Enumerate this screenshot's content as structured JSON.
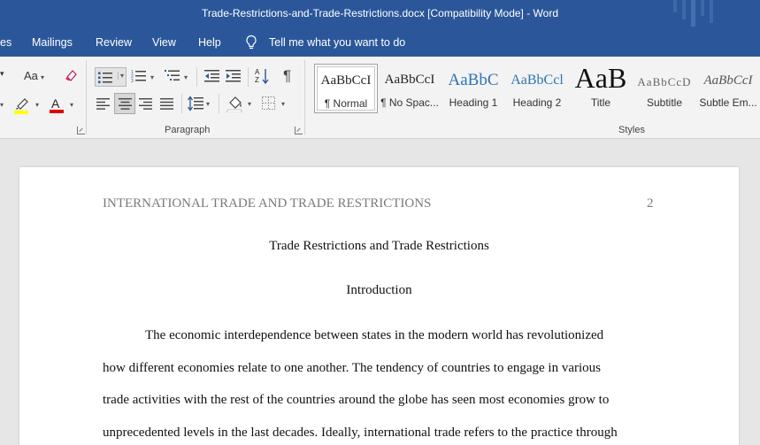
{
  "window": {
    "title": "Trade-Restrictions-and-Trade-Restrictions.docx [Compatibility Mode]  -  Word",
    "theme_color": "#2b579a"
  },
  "menu": {
    "items": [
      "es",
      "Mailings",
      "Review",
      "View",
      "Help"
    ],
    "tell_me": "Tell me what you want to do"
  },
  "ribbon": {
    "font_group": {
      "change_case_label": "Aa",
      "highlight_color": "#ffff00",
      "font_color": "#e00000"
    },
    "paragraph_group": {
      "label": "Paragraph",
      "pilcrow": "¶"
    },
    "styles_group": {
      "label": "Styles",
      "styles": [
        {
          "sample": "AaBbCcI",
          "name": "¶ Normal"
        },
        {
          "sample": "AaBbCcI",
          "name": "¶ No Spac..."
        },
        {
          "sample": "AaBbC",
          "name": "Heading 1"
        },
        {
          "sample": "AaBbCcl",
          "name": "Heading 2"
        },
        {
          "sample": "AaB",
          "name": "Title"
        },
        {
          "sample": "AaBbCcD",
          "name": "Subtitle"
        },
        {
          "sample": "AaBbCcI",
          "name": "Subtle Em..."
        }
      ]
    }
  },
  "document": {
    "header": "INTERNATIONAL TRADE AND TRADE RESTRICTIONS",
    "page_number": "2",
    "title": "Trade Restrictions and Trade Restrictions",
    "heading": "Introduction",
    "body_lines": [
      "The economic interdependence between states in the modern world has revolutionized",
      "how different economies relate to one another. The tendency of countries to engage in various",
      "trade activities with the rest of the countries around the globe has seen most economies grow to",
      "unprecedented levels in the last decades. Ideally, international trade refers to the practice through"
    ]
  }
}
